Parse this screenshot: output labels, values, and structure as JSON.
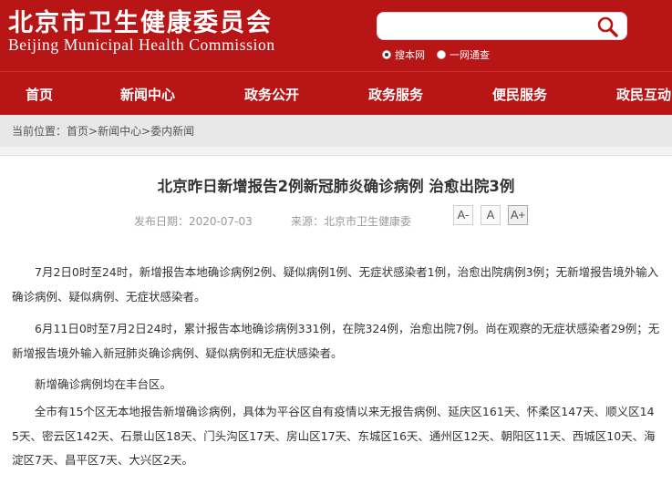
{
  "header": {
    "logo_cn": "北京市卫生健康委员会",
    "logo_en": "Beijing Municipal Health Commission",
    "search": {
      "value": "",
      "placeholder": ""
    },
    "scope": {
      "site_label": "搜本网",
      "portal_label": "一网通查",
      "selected": "site"
    }
  },
  "nav": {
    "items": [
      {
        "label": "首页"
      },
      {
        "label": "新闻中心"
      },
      {
        "label": "政务公开"
      },
      {
        "label": "政务服务"
      },
      {
        "label": "便民服务"
      },
      {
        "label": "政民互动"
      }
    ]
  },
  "breadcrumb": {
    "prefix": "当前位置：",
    "items": [
      "首页",
      "新闻中心",
      "委内新闻"
    ],
    "separator": ">"
  },
  "article": {
    "title": "北京昨日新增报告2例新冠肺炎确诊病例 治愈出院3例",
    "date_text": "发布日期：2020-07-03",
    "source_text": "来源：北京市卫生健康委",
    "font_sizes": [
      "A-",
      "A",
      "A+"
    ],
    "paragraphs": [
      "7月2日0时至24时，新增报告本地确诊病例2例、疑似病例1例、无症状感染者1例，治愈出院病例3例；无新增报告境外输入确诊病例、疑似病例、无症状感染者。",
      "6月11日0时至7月2日24时，累计报告本地确诊病例331例，在院324例，治愈出院7例。尚在观察的无症状感染者29例；无新增报告境外输入新冠肺炎确诊病例、疑似病例和无症状感染者。",
      "新增确诊病例均在丰台区。",
      "全市有15个区无本地报告新增确诊病例，具体为平谷区自有疫情以来无报告病例、延庆区161天、怀柔区147天、顺义区145天、密云区142天、石景山区18天、门头沟区17天、房山区17天、东城区16天、通州区12天、朝阳区11天、西城区10天、海淀区7天、昌平区7天、大兴区2天。"
    ]
  },
  "colors": {
    "brand_red": "#b81516",
    "page_bg": "#f3f3f3"
  }
}
